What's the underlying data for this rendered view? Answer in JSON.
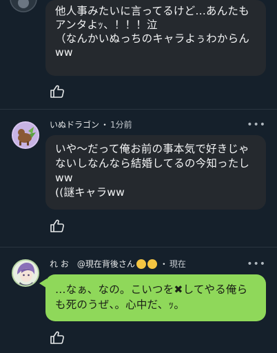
{
  "post1": {
    "text": "他人事みたいに言ってるけど…あんたも\nアンタよｯ、！！！泣\n（なんかいぬっちのキャラよぅわからん\nww"
  },
  "post2": {
    "username": "いぬドラゴン",
    "separator": "・",
    "time": "1分前",
    "text": "いや〜だって俺お前の事本気で好きじゃ\nないしなんなら結婚してるの今知ったし\nww\n((謎キャラww"
  },
  "post3": {
    "username": "れ お",
    "mention": "@現在背後さん",
    "separator": "・",
    "time": "現在",
    "text": "…なぁ、なの。こいつを✖︎してやる俺ら\nも死のうぜ、。心中だ、ｯ。"
  },
  "icons": {
    "like": "thumbs-up-icon",
    "more": "more-horizontal-icon"
  },
  "colors": {
    "background": "#15202b",
    "bubble": "#25292e",
    "bubble_self": "#8fd85a"
  },
  "more_glyph": "•••"
}
